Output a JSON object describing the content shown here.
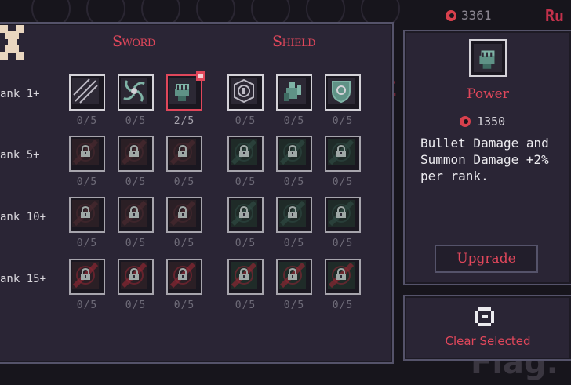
{
  "top_bar": {
    "soul_count": "3361",
    "run_label": "Ru"
  },
  "background": {
    "flag_text": "Flag."
  },
  "upgrades": {
    "columns": [
      {
        "label": "Sword"
      },
      {
        "label": "Shield"
      }
    ],
    "rows": [
      {
        "rank_label": "ank 1+",
        "slots": [
          {
            "name": "slash-upgrade",
            "count": "0/5",
            "locked": false
          },
          {
            "name": "vortex-upgrade",
            "count": "0/5",
            "locked": false
          },
          {
            "name": "power-upgrade",
            "count": "2/5",
            "locked": false,
            "selected": true
          },
          {
            "name": "ward-upgrade",
            "count": "0/5",
            "locked": false
          },
          {
            "name": "guardian-upgrade",
            "count": "0/5",
            "locked": false
          },
          {
            "name": "crest-upgrade",
            "count": "0/5",
            "locked": false
          }
        ]
      },
      {
        "rank_label": "ank 5+",
        "slots": [
          {
            "name": "locked-upgrade",
            "count": "0/5",
            "locked": true
          },
          {
            "name": "locked-upgrade",
            "count": "0/5",
            "locked": true
          },
          {
            "name": "locked-upgrade",
            "count": "0/5",
            "locked": true
          },
          {
            "name": "locked-upgrade",
            "count": "0/5",
            "locked": true
          },
          {
            "name": "locked-upgrade",
            "count": "0/5",
            "locked": true
          },
          {
            "name": "locked-upgrade",
            "count": "0/5",
            "locked": true
          }
        ]
      },
      {
        "rank_label": "ank 10+",
        "slots": [
          {
            "name": "locked-upgrade",
            "count": "0/5",
            "locked": true
          },
          {
            "name": "locked-upgrade",
            "count": "0/5",
            "locked": true
          },
          {
            "name": "locked-upgrade",
            "count": "0/5",
            "locked": true
          },
          {
            "name": "locked-upgrade",
            "count": "0/5",
            "locked": true
          },
          {
            "name": "locked-upgrade",
            "count": "0/5",
            "locked": true
          },
          {
            "name": "locked-upgrade",
            "count": "0/5",
            "locked": true
          }
        ]
      },
      {
        "rank_label": "ank 15+",
        "slots": [
          {
            "name": "locked-upgrade",
            "count": "0/5",
            "locked": true
          },
          {
            "name": "locked-upgrade",
            "count": "0/5",
            "locked": true
          },
          {
            "name": "locked-upgrade",
            "count": "0/5",
            "locked": true
          },
          {
            "name": "locked-upgrade",
            "count": "0/5",
            "locked": true
          },
          {
            "name": "locked-upgrade",
            "count": "0/5",
            "locked": true
          },
          {
            "name": "locked-upgrade",
            "count": "0/5",
            "locked": true
          }
        ]
      }
    ]
  },
  "info": {
    "icon": "fist-icon",
    "title": "Power",
    "cost": "1350",
    "description": "Bullet Damage and Summon Damage +2% per rank.",
    "upgrade_label": "Upgrade"
  },
  "clear": {
    "label": "Clear Selected"
  },
  "colors": {
    "accent": "#e0475b",
    "panel": "#2a2535",
    "border": "#55536a",
    "text": "#ecebef",
    "muted": "#6e6b78"
  }
}
